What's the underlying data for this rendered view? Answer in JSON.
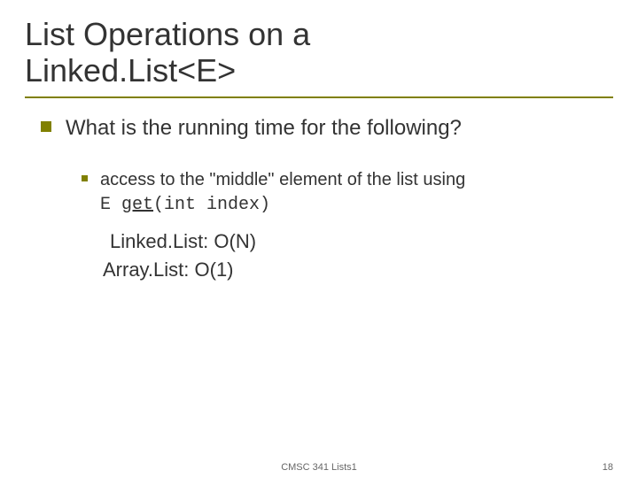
{
  "title_line1": "List Operations on a",
  "title_line2": "Linked.List<E>",
  "bullet_l1": "What is the running time for the following?",
  "bullet_l2_part1": "access to the \"middle\" element of the list using",
  "bullet_l2_code_prefix": "E ",
  "bullet_l2_code_method": "get",
  "bullet_l2_code_args": "(int index)",
  "answer_linked": "Linked.List:  O(N)",
  "answer_array": "Array.List: O(1)",
  "footer_center": "CMSC 341 Lists1",
  "footer_right": "18"
}
